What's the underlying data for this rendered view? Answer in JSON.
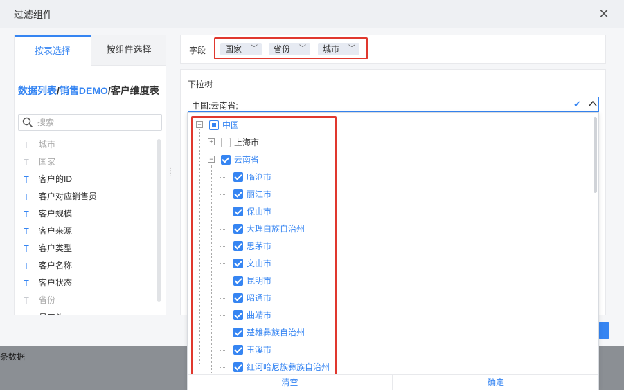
{
  "dialog": {
    "title": "过滤组件",
    "close_icon": "close-icon"
  },
  "left_panel": {
    "tabs": [
      {
        "label": "按表选择",
        "active": true
      },
      {
        "label": "按组件选择",
        "active": false
      }
    ],
    "breadcrumb": {
      "part1": "数据列表",
      "sep1": "/",
      "part2": "销售DEMO",
      "sep2": "/",
      "part3": "客户维度表"
    },
    "search": {
      "placeholder": "搜索"
    },
    "fields": [
      {
        "label": "城市",
        "type_icon": "T",
        "dim": true
      },
      {
        "label": "国家",
        "type_icon": "T",
        "dim": true
      },
      {
        "label": "客户的ID",
        "type_icon": "T",
        "dim": false
      },
      {
        "label": "客户对应销售员",
        "type_icon": "T",
        "dim": false
      },
      {
        "label": "客户规模",
        "type_icon": "T",
        "dim": false
      },
      {
        "label": "客户来源",
        "type_icon": "T",
        "dim": false
      },
      {
        "label": "客户类型",
        "type_icon": "T",
        "dim": false
      },
      {
        "label": "客户名称",
        "type_icon": "T",
        "dim": false
      },
      {
        "label": "客户状态",
        "type_icon": "T",
        "dim": false
      },
      {
        "label": "省份",
        "type_icon": "T",
        "dim": true
      },
      {
        "label": "员工头…",
        "type_icon": "T",
        "dim": false
      }
    ]
  },
  "field_row": {
    "label": "字段",
    "chips": [
      "国家",
      "省份",
      "城市"
    ]
  },
  "dropdown_tree": {
    "label": "下拉树",
    "value": "中国:云南省;",
    "nodes": [
      {
        "label": "中国",
        "level": 0,
        "state": "partial",
        "toggle": "−",
        "color": "blue"
      },
      {
        "label": "上海市",
        "level": 1,
        "state": "empty",
        "toggle": "+",
        "color": "dark"
      },
      {
        "label": "云南省",
        "level": 1,
        "state": "checked",
        "toggle": "−",
        "color": "blue"
      },
      {
        "label": "临沧市",
        "level": 2,
        "state": "checked",
        "color": "blue"
      },
      {
        "label": "丽江市",
        "level": 2,
        "state": "checked",
        "color": "blue"
      },
      {
        "label": "保山市",
        "level": 2,
        "state": "checked",
        "color": "blue"
      },
      {
        "label": "大理白族自治州",
        "level": 2,
        "state": "checked",
        "color": "blue"
      },
      {
        "label": "思茅市",
        "level": 2,
        "state": "checked",
        "color": "blue"
      },
      {
        "label": "文山市",
        "level": 2,
        "state": "checked",
        "color": "blue"
      },
      {
        "label": "昆明市",
        "level": 2,
        "state": "checked",
        "color": "blue"
      },
      {
        "label": "昭通市",
        "level": 2,
        "state": "checked",
        "color": "blue"
      },
      {
        "label": "曲靖市",
        "level": 2,
        "state": "checked",
        "color": "blue"
      },
      {
        "label": "楚雄彝族自治州",
        "level": 2,
        "state": "checked",
        "color": "blue"
      },
      {
        "label": "玉溪市",
        "level": 2,
        "state": "checked",
        "color": "blue"
      },
      {
        "label": "红河哈尼族彝族自治州",
        "level": 2,
        "state": "checked",
        "color": "blue"
      }
    ],
    "footer": {
      "clear": "清空",
      "confirm": "确定"
    }
  },
  "background": {
    "row_text": "条数据"
  },
  "colors": {
    "accent": "#3685f2",
    "highlight": "#e0382e"
  }
}
